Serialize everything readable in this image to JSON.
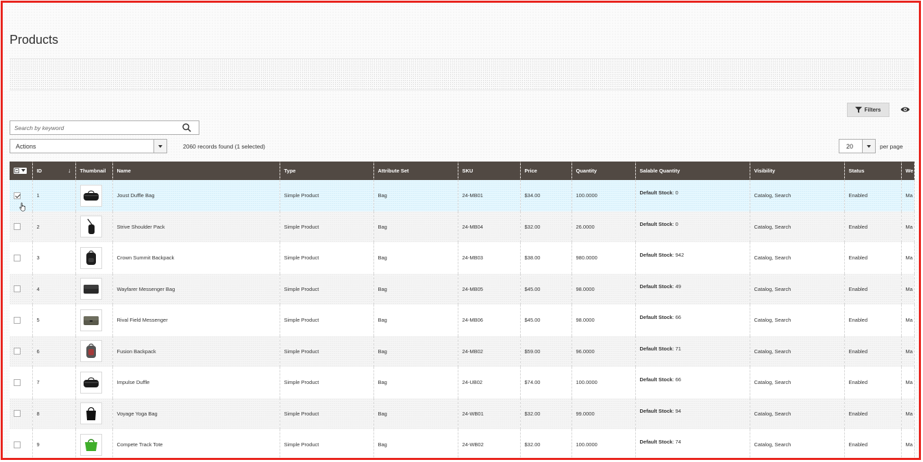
{
  "page": {
    "title": "Products"
  },
  "toolbar": {
    "filters_label": "Filters",
    "search_placeholder": "Search by keyword",
    "actions_label": "Actions",
    "records_text": "2060 records found (1 selected)",
    "per_page_value": "20",
    "per_page_label": "per page"
  },
  "columns": [
    "ID",
    "Thumbnail",
    "Name",
    "Type",
    "Attribute Set",
    "SKU",
    "Price",
    "Quantity",
    "Salable Quantity",
    "Visibility",
    "Status",
    "We"
  ],
  "rows": [
    {
      "id": "1",
      "name": "Joust Duffle Bag",
      "type": "Simple Product",
      "attr": "Bag",
      "sku": "24-MB01",
      "price": "$34.00",
      "qty": "100.0000",
      "stock_label": "Default Stock",
      "stock_value": ": 0",
      "visibility": "Catalog, Search",
      "status": "Enabled",
      "web": "Ma",
      "checked": true
    },
    {
      "id": "2",
      "name": "Strive Shoulder Pack",
      "type": "Simple Product",
      "attr": "Bag",
      "sku": "24-MB04",
      "price": "$32.00",
      "qty": "26.0000",
      "stock_label": "Default Stock",
      "stock_value": ": 0",
      "visibility": "Catalog, Search",
      "status": "Enabled",
      "web": "Ma",
      "checked": false
    },
    {
      "id": "3",
      "name": "Crown Summit Backpack",
      "type": "Simple Product",
      "attr": "Bag",
      "sku": "24-MB03",
      "price": "$38.00",
      "qty": "980.0000",
      "stock_label": "Default Stock",
      "stock_value": ": 942",
      "visibility": "Catalog, Search",
      "status": "Enabled",
      "web": "Ma",
      "checked": false
    },
    {
      "id": "4",
      "name": "Wayfarer Messenger Bag",
      "type": "Simple Product",
      "attr": "Bag",
      "sku": "24-MB05",
      "price": "$45.00",
      "qty": "98.0000",
      "stock_label": "Default Stock",
      "stock_value": ": 49",
      "visibility": "Catalog, Search",
      "status": "Enabled",
      "web": "Ma",
      "checked": false
    },
    {
      "id": "5",
      "name": "Rival Field Messenger",
      "type": "Simple Product",
      "attr": "Bag",
      "sku": "24-MB06",
      "price": "$45.00",
      "qty": "98.0000",
      "stock_label": "Default Stock",
      "stock_value": ": 66",
      "visibility": "Catalog, Search",
      "status": "Enabled",
      "web": "Ma",
      "checked": false
    },
    {
      "id": "6",
      "name": "Fusion Backpack",
      "type": "Simple Product",
      "attr": "Bag",
      "sku": "24-MB02",
      "price": "$59.00",
      "qty": "96.0000",
      "stock_label": "Default Stock",
      "stock_value": ": 71",
      "visibility": "Catalog, Search",
      "status": "Enabled",
      "web": "Ma",
      "checked": false
    },
    {
      "id": "7",
      "name": "Impulse Duffle",
      "type": "Simple Product",
      "attr": "Bag",
      "sku": "24-UB02",
      "price": "$74.00",
      "qty": "100.0000",
      "stock_label": "Default Stock",
      "stock_value": ": 66",
      "visibility": "Catalog, Search",
      "status": "Enabled",
      "web": "Ma",
      "checked": false
    },
    {
      "id": "8",
      "name": "Voyage Yoga Bag",
      "type": "Simple Product",
      "attr": "Bag",
      "sku": "24-WB01",
      "price": "$32.00",
      "qty": "99.0000",
      "stock_label": "Default Stock",
      "stock_value": ": 94",
      "visibility": "Catalog, Search",
      "status": "Enabled",
      "web": "Ma",
      "checked": false
    },
    {
      "id": "9",
      "name": "Compete Track Tote",
      "type": "Simple Product",
      "attr": "Bag",
      "sku": "24-WB02",
      "price": "$32.00",
      "qty": "100.0000",
      "stock_label": "Default Stock",
      "stock_value": ": 74",
      "visibility": "Catalog, Search",
      "status": "Enabled",
      "web": "Ma",
      "checked": false
    }
  ],
  "thumb_icons": [
    "duffle-bag-icon",
    "shoulder-pack-icon",
    "backpack-icon",
    "messenger-bag-icon",
    "messenger-bag-icon",
    "backpack-icon",
    "duffle-bag-icon",
    "tote-bag-icon",
    "tote-bag-icon"
  ],
  "colors": {
    "header_bg": "#514943",
    "selected_row": "#e5f7fe",
    "frame_border": "#e8231c",
    "green_tote": "#3fae2a"
  }
}
